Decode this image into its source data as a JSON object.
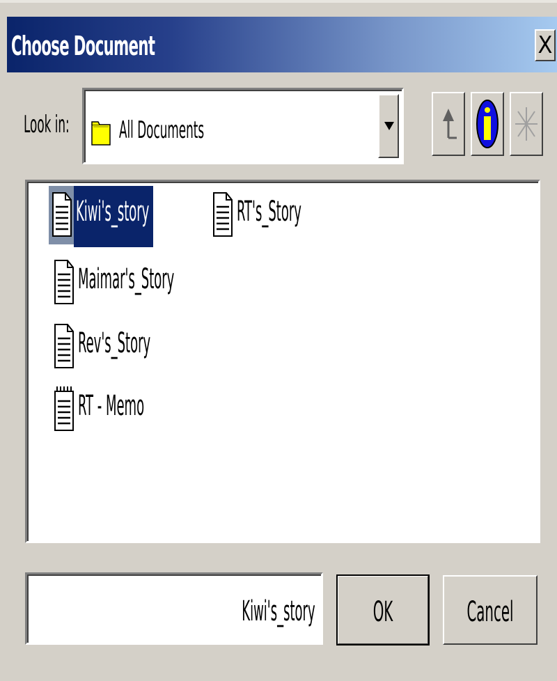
{
  "window": {
    "title": "Choose Document",
    "close_label": "X"
  },
  "look_in": {
    "label": "Look in:",
    "selected": "All Documents",
    "icon": "folder-icon"
  },
  "toolbar": {
    "up_icon": "up-folder-icon",
    "info_icon": "info-icon",
    "new_icon": "sparkle-icon"
  },
  "files": [
    {
      "name": "Kiwi's_story",
      "icon": "document-icon",
      "selected": true
    },
    {
      "name": "RT's_Story",
      "icon": "document-icon",
      "selected": false
    },
    {
      "name": "Maimar's_Story",
      "icon": "document-icon",
      "selected": false
    },
    {
      "name": "Rev's_Story",
      "icon": "document-icon",
      "selected": false
    },
    {
      "name": "RT - Memo",
      "icon": "memo-icon",
      "selected": false
    }
  ],
  "file_name_field": {
    "value": "Kiwi's_story"
  },
  "buttons": {
    "ok": "OK",
    "cancel": "Cancel"
  },
  "colors": {
    "title_gradient_start": "#0a246a",
    "title_gradient_end": "#a6caf0",
    "selection": "#0a246a",
    "face": "#d4d0c8"
  }
}
